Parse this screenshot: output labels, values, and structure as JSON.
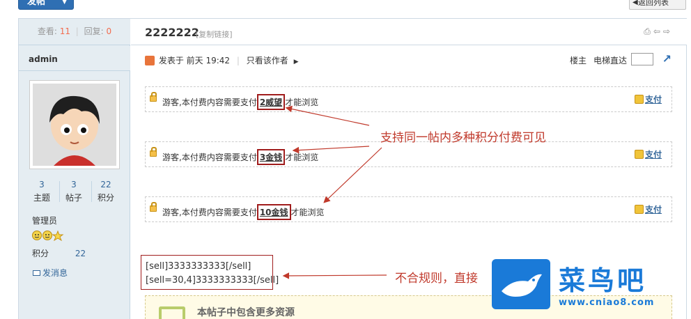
{
  "toolbar": {
    "post_button": "发帖",
    "back_button": "返回列表"
  },
  "thread_stats": {
    "views_label": "查看:",
    "views": "11",
    "replies_label": "回复:",
    "replies": "0"
  },
  "thread": {
    "title": "2222222",
    "copy_link": "[复制链接]"
  },
  "author": {
    "name": "admin",
    "stats": [
      {
        "value": "3",
        "label": "主题"
      },
      {
        "value": "3",
        "label": "帖子"
      },
      {
        "value": "22",
        "label": "积分"
      }
    ],
    "role": "管理员",
    "points_label": "积分",
    "points_value": "22",
    "message_link": "发消息"
  },
  "post_meta": {
    "posted_prefix": "发表于 前天 19:42",
    "only_author": "只看该作者",
    "floor": "楼主",
    "elevator": "电梯直达"
  },
  "pay_boxes": [
    {
      "prefix": "游客,本付费内容需要支付",
      "amount": "2威望",
      "suffix": "才能浏览",
      "pay": "支付"
    },
    {
      "prefix": "游客,本付费内容需要支付",
      "amount": "3金钱",
      "suffix": "才能浏览",
      "pay": "支付"
    },
    {
      "prefix": "游客,本付费内容需要支付",
      "amount": "10金钱",
      "suffix": "才能浏览",
      "pay": "支付"
    }
  ],
  "annotations": {
    "top": "支持同一帖内多种积分付费可见",
    "bottom": "不合规则，直接"
  },
  "code_lines": [
    "[sell]3333333333[/sell]",
    "[sell=30,4]3333333333[/sell]"
  ],
  "resource_box": {
    "title": "本帖子中包含更多资源"
  },
  "watermark": {
    "name": "菜鸟吧",
    "url": "www.cniao8.com"
  },
  "colors": {
    "accent": "#2f6fb3",
    "annotation": "#c0392b",
    "link": "#336699"
  }
}
